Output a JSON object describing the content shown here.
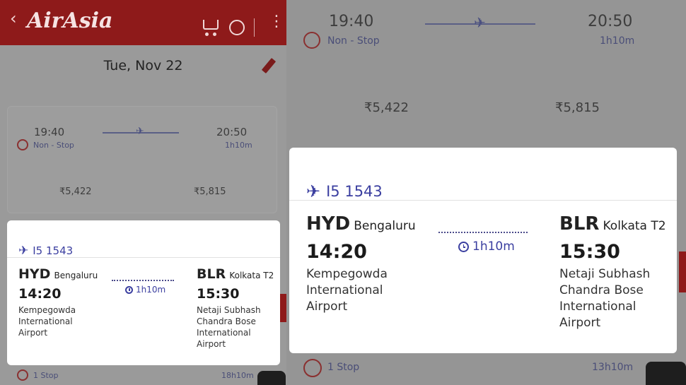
{
  "app": {
    "logo_text": "AirAsia",
    "back_icon": "back-arrow-icon",
    "icons": [
      "cart-icon",
      "globe-icon",
      "more-vert-icon"
    ]
  },
  "date_bar": {
    "date": "Tue, Nov 22",
    "edit_icon": "pencil-icon"
  },
  "background_flights": {
    "left": {
      "depart": "19:40",
      "arrive": "20:50",
      "stops": "Non - Stop",
      "duration": "1h10m",
      "fare_1": "₹5,422",
      "fare_2": "₹5,815",
      "next_stops": "1 Stop",
      "next_duration": "18h10m"
    },
    "right": {
      "depart": "19:40",
      "arrive": "20:50",
      "stops": "Non - Stop",
      "duration": "1h10m",
      "fare_1": "₹5,422",
      "fare_2": "₹5,815",
      "next_stops": "1 Stop",
      "next_duration": "13h10m"
    }
  },
  "flight_popup": {
    "flight_number": "I5 1543",
    "origin": {
      "code": "HYD",
      "city": "Bengaluru",
      "time": "14:20",
      "airport_lines": [
        "Kempegowda",
        "International",
        "Airport"
      ]
    },
    "destination": {
      "code": "BLR",
      "city": "Kolkata T2",
      "time": "15:30",
      "airport_lines": [
        "Netaji Subhash",
        "Chandra Bose",
        "International",
        "Airport"
      ]
    },
    "duration": "1h10m"
  },
  "colors": {
    "brand_red": "#e31e24",
    "accent_blue": "#3b3fa0"
  }
}
